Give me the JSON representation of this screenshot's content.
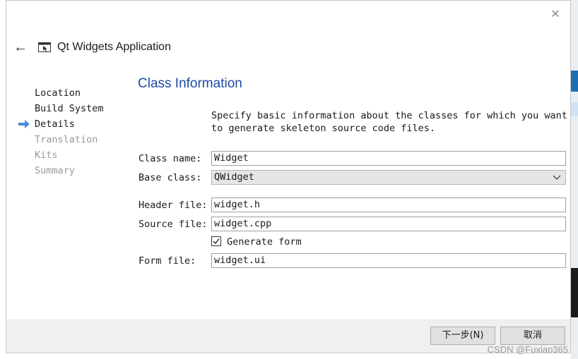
{
  "window": {
    "close_glyph": "✕",
    "title": "Qt Widgets Application",
    "back_glyph": "←"
  },
  "steps": [
    {
      "label": "Location",
      "state": "done"
    },
    {
      "label": "Build System",
      "state": "done"
    },
    {
      "label": "Details",
      "state": "current"
    },
    {
      "label": "Translation",
      "state": "future"
    },
    {
      "label": "Kits",
      "state": "future"
    },
    {
      "label": "Summary",
      "state": "future"
    }
  ],
  "page": {
    "title": "Class Information",
    "description": "Specify basic information about the classes for which you want to generate skeleton source code files."
  },
  "form": {
    "class_name_label": "Class name:",
    "class_name_value": "Widget",
    "base_class_label": "Base class:",
    "base_class_value": "QWidget",
    "header_file_label": "Header file:",
    "header_file_value": "widget.h",
    "source_file_label": "Source file:",
    "source_file_value": "widget.cpp",
    "generate_form_label": "Generate form",
    "generate_form_checked": true,
    "form_file_label": "Form file:",
    "form_file_value": "widget.ui"
  },
  "footer": {
    "next_label": "下一步(N)",
    "cancel_label": "取消"
  },
  "watermark": "CSDN @Fuxiao365",
  "colors": {
    "section_title": "#1c4aa5",
    "step_arrow": "#4a8fd8",
    "disabled_text": "#9a9a9a"
  }
}
